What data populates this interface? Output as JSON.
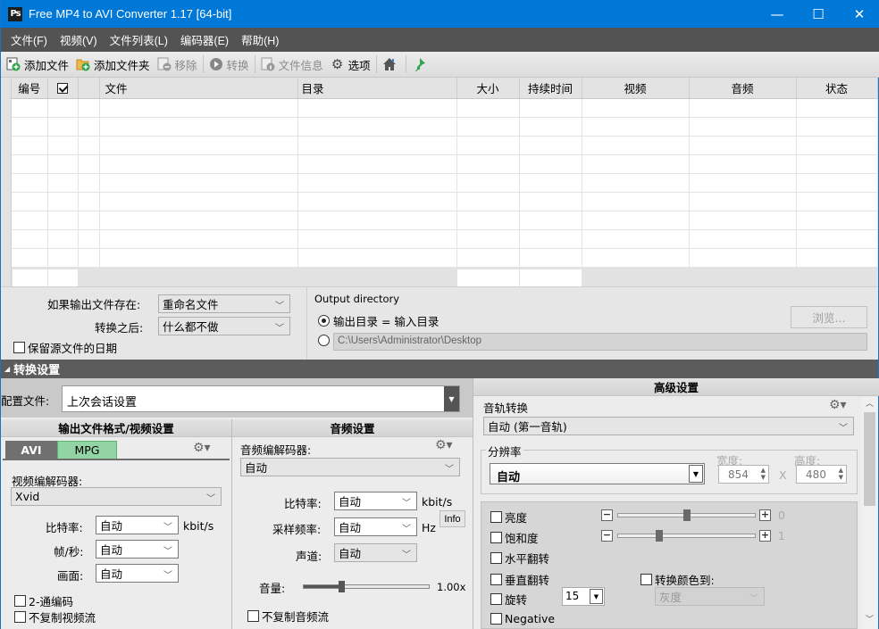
{
  "window": {
    "title": "Free MP4 to AVI Converter 1.17  [64-bit]",
    "app_icon": "Ps",
    "controls": {
      "minimize": "—",
      "maximize": "☐",
      "close": "✕"
    }
  },
  "menubar": [
    "文件(F)",
    "视频(V)",
    "文件列表(L)",
    "编码器(E)",
    "帮助(H)"
  ],
  "toolbar": {
    "add_file": "添加文件",
    "add_folder": "添加文件夹",
    "remove": "移除",
    "convert": "转换",
    "file_info": "文件信息",
    "options": "选项"
  },
  "file_table": {
    "columns": [
      "编号",
      "☑",
      "",
      "文件",
      "目录",
      "大小",
      "持续时间",
      "视频",
      "音频",
      "状态"
    ],
    "rows": []
  },
  "output_options": {
    "if_exists_label": "如果输出文件存在:",
    "if_exists_value": "重命名文件",
    "after_convert_label": "转换之后:",
    "after_convert_value": "什么都不做",
    "keep_date_label": "保留源文件的日期",
    "output_dir_title": "Output directory",
    "radio_same_dir": "输出目录 = 输入目录",
    "custom_dir_path": "C:\\Users\\Administrator\\Desktop",
    "browse_label": "浏览..."
  },
  "conversion": {
    "header": "转换设置",
    "profile_label": "配置文件:",
    "profile_value": "上次会话设置"
  },
  "video_settings": {
    "title": "输出文件格式/视频设置",
    "tabs": [
      "AVI",
      "MPG"
    ],
    "codec_label": "视频编解码器:",
    "codec_value": "Xvid",
    "bitrate_label": "比特率:",
    "bitrate_value": "自动",
    "bitrate_unit": "kbit/s",
    "fps_label": "帧/秒:",
    "fps_value": "自动",
    "size_label": "画面:",
    "size_value": "自动",
    "twopass_label": "2-通编码",
    "nocopy_label": "不复制视频流"
  },
  "audio_settings": {
    "title": "音频设置",
    "codec_label": "音频编解码器:",
    "codec_value": "自动",
    "bitrate_label": "比特率:",
    "bitrate_value": "自动",
    "bitrate_unit": "kbit/s",
    "samplerate_label": "采样频率:",
    "samplerate_value": "自动",
    "samplerate_unit": "Hz",
    "info_label": "Info",
    "channels_label": "声道:",
    "channels_value": "自动",
    "volume_label": "音量:",
    "volume_value": "1.00x",
    "volume_fraction": 0.3,
    "nocopy_label": "不复制音频流"
  },
  "advanced_settings": {
    "title": "高级设置",
    "track_label": "音轨转换",
    "track_value": "自动 (第一音轨)",
    "resolution_group": "分辨率",
    "resolution_value": "自动",
    "width_label": "宽度:",
    "width_value": "854",
    "x_sep": "X",
    "height_label": "高度:",
    "height_value": "480",
    "brightness_label": "亮度",
    "brightness_value": "0",
    "brightness_fraction": 0.5,
    "saturation_label": "饱和度",
    "saturation_value": "1",
    "saturation_fraction": 0.3,
    "hflip_label": "水平翻转",
    "vflip_label": "垂直翻转",
    "convert_color_label": "转换颜色到:",
    "color_value": "灰度",
    "rotate_label": "旋转",
    "rotate_value": "15",
    "negative_label": "Negative"
  }
}
